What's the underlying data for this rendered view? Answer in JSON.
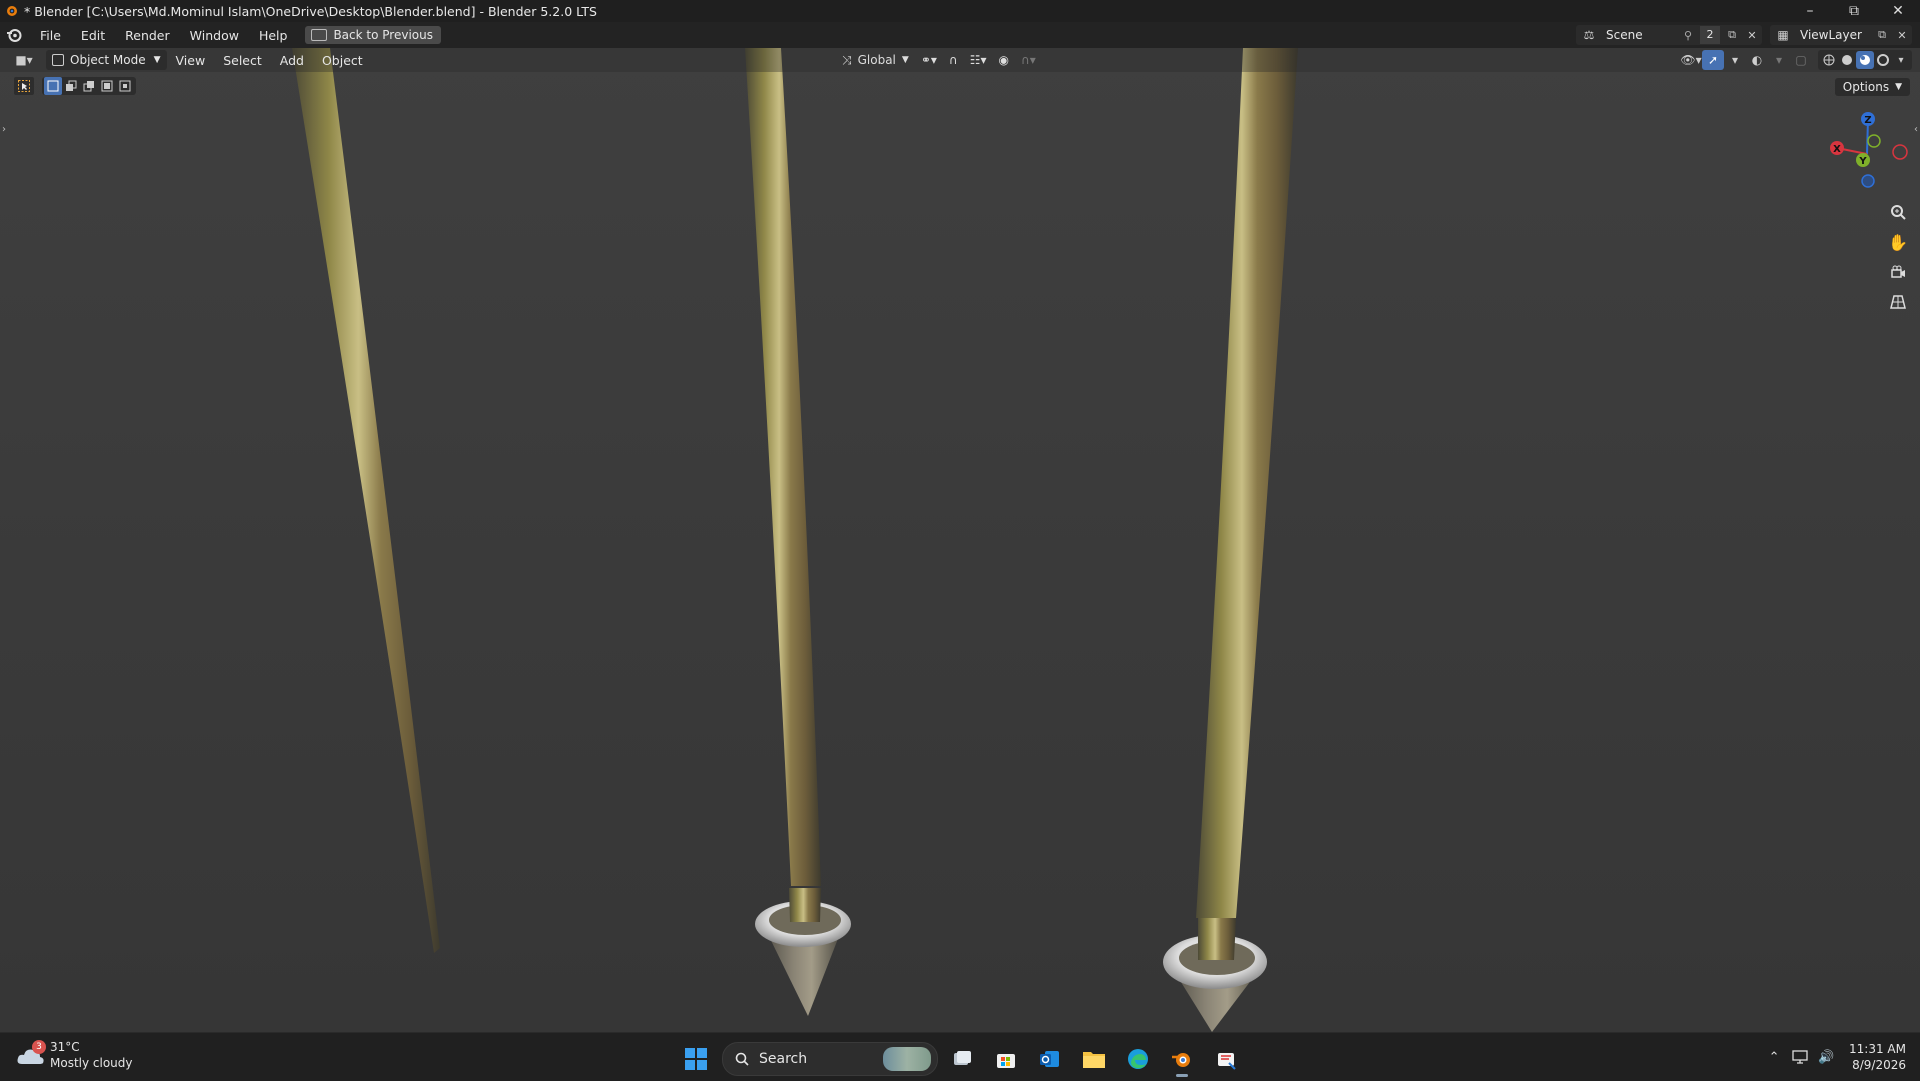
{
  "window": {
    "title": "* Blender [C:\\Users\\Md.Mominul Islam\\OneDrive\\Desktop\\Blender.blend] - Blender 5.2.0 LTS",
    "controls": [
      "minimize",
      "restore",
      "close"
    ]
  },
  "menubar": {
    "items": [
      "File",
      "Edit",
      "Render",
      "Window",
      "Help"
    ],
    "back_button": "Back to Previous",
    "scene": {
      "name": "Scene",
      "user_count": "2"
    },
    "view_layer": "ViewLayer"
  },
  "viewport_header": {
    "mode": "Object Mode",
    "menus": [
      "View",
      "Select",
      "Add",
      "Object"
    ],
    "transform_orientation": "Global",
    "options_label": "Options"
  },
  "gizmo": {
    "axes": {
      "z": "Z",
      "x": "X",
      "y": "Y"
    },
    "colors": {
      "x": "#d8353f",
      "y": "#7fb02a",
      "z": "#2f6fd6"
    }
  },
  "nav_buttons": [
    "zoom-icon",
    "pan-hand-icon",
    "camera-icon",
    "perspective-grid-icon"
  ],
  "viewport": {
    "background": "#3a3a3a",
    "object_color": "#8a7a4a"
  },
  "taskbar": {
    "weather": {
      "temp": "31°C",
      "condition": "Mostly cloudy",
      "badge": "3"
    },
    "search_label": "Search",
    "apps": [
      "task-view-icon",
      "store-icon",
      "outlook-icon",
      "file-explorer-icon",
      "edge-icon",
      "blender-icon",
      "snipping-tool-icon"
    ],
    "time": "11:31 AM",
    "date": "8/9/2026"
  }
}
